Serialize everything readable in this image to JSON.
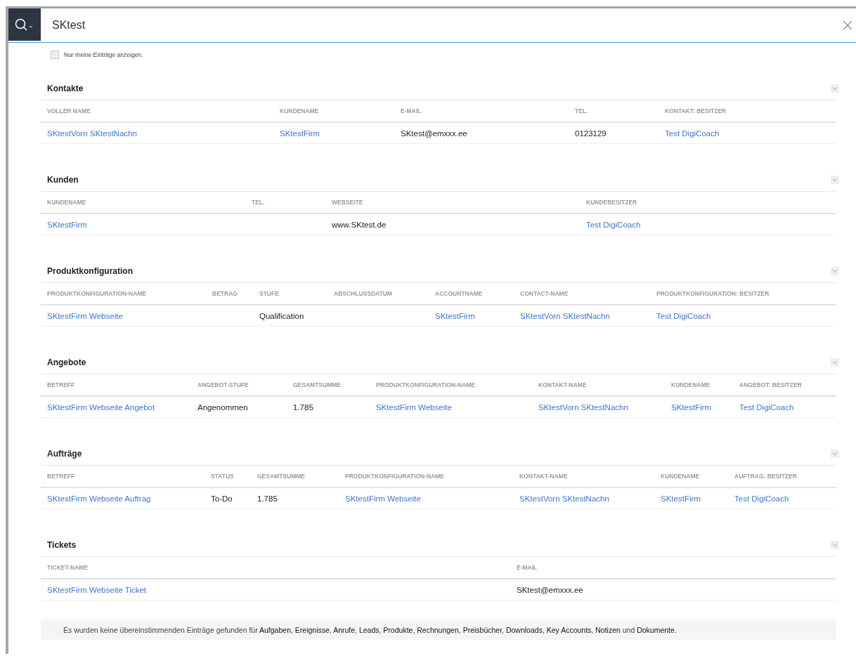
{
  "search": {
    "value": "SKtest"
  },
  "filter": {
    "label": "Nur meine Einträge anzeigen.",
    "checked": false
  },
  "sections": [
    {
      "title": "Kontakte",
      "expanded": true,
      "columns": [
        "VOLLER NAME",
        "KUNDENAME",
        "E-MAIL",
        "TEL.",
        "KONTAKT: BESITZER"
      ],
      "rows": [
        [
          {
            "text": "SKtestVorn SKtestNachn",
            "kind": "link"
          },
          {
            "text": "SKtestFirm",
            "kind": "link"
          },
          {
            "text": "SKtest@emxxx.ee",
            "kind": "text"
          },
          {
            "text": "0123129",
            "kind": "text"
          },
          {
            "text": "Test DigiCoach",
            "kind": "link"
          }
        ]
      ]
    },
    {
      "title": "Kunden",
      "expanded": true,
      "columns": [
        "KUNDENAME",
        "TEL.",
        "WEBSEITE",
        "KUNDEBESITZER"
      ],
      "rows": [
        [
          {
            "text": "SKtestFirm",
            "kind": "link"
          },
          null,
          {
            "text": "www.SKtest.de",
            "kind": "text"
          },
          {
            "text": "Test DigiCoach",
            "kind": "link"
          }
        ]
      ]
    },
    {
      "title": "Produktkonfiguration",
      "expanded": true,
      "columns": [
        "PRODUKTKONFIGURATION-NAME",
        "BETRAG",
        "STUFE",
        "ABSCHLUSSDATUM",
        "ACCOUNTNAME",
        "CONTACT-NAME",
        "PRODUKTKONFIGURATION: BESITZER"
      ],
      "rows": [
        [
          {
            "text": "SKtestFirm Webseite",
            "kind": "link"
          },
          null,
          {
            "text": "Qualification",
            "kind": "text"
          },
          null,
          {
            "text": "SKtestFirm",
            "kind": "link"
          },
          {
            "text": "SKtestVorn SKtestNachn",
            "kind": "link"
          },
          {
            "text": "Test DigiCoach",
            "kind": "link"
          }
        ]
      ]
    },
    {
      "title": "Angebote",
      "expanded": true,
      "columns": [
        "BETREFF",
        "ANGEBOT-STUFE",
        "GESAMTSUMME",
        "PRODUKTKONFIGURATION-NAME",
        "KONTAKT-NAME",
        "KUNDENAME",
        "ANGEBOT: BESITZER"
      ],
      "rows": [
        [
          {
            "text": "SKtestFirm Webseite Angebot",
            "kind": "link"
          },
          {
            "text": "Angenommen",
            "kind": "text"
          },
          {
            "text": "1.785",
            "kind": "text"
          },
          {
            "text": "SKtestFirm Webseite",
            "kind": "link"
          },
          {
            "text": "SKtestVorn SKtestNachn",
            "kind": "link"
          },
          {
            "text": "SKtestFirm",
            "kind": "link"
          },
          {
            "text": "Test DigiCoach",
            "kind": "link"
          }
        ]
      ]
    },
    {
      "title": "Aufträge",
      "expanded": true,
      "columns": [
        "BETREFF",
        "STATUS",
        "GESAMTSUMME",
        "PRODUKTKONFIGURATION-NAME",
        "KONTAKT-NAME",
        "KUNDENAME",
        "AUFTRAG: BESITZER"
      ],
      "rows": [
        [
          {
            "text": "SKtestFirm Webseite Auftrag",
            "kind": "link"
          },
          {
            "text": "To-Do",
            "kind": "text"
          },
          {
            "text": "1.785",
            "kind": "text"
          },
          {
            "text": "SKtestFirm Webseite",
            "kind": "link"
          },
          {
            "text": "SKtestVorn SKtestNachn",
            "kind": "link"
          },
          {
            "text": "SKtestFirm",
            "kind": "link"
          },
          {
            "text": "Test DigiCoach",
            "kind": "link"
          }
        ]
      ]
    },
    {
      "title": "Tickets",
      "expanded": true,
      "columns": [
        "TICKET-NAME",
        "E-MAIL"
      ],
      "rows": [
        [
          {
            "text": "SKtestFirm Webseite Ticket",
            "kind": "link"
          },
          {
            "text": "SKtest@emxxx.ee",
            "kind": "text"
          }
        ]
      ]
    }
  ],
  "footer": "Es wurden keine übereinstimmenden Einträge gefunden für **Aufgaben**, **Ereignisse**, **Anrufe**, **Leads**, **Produkte**, **Rechnungen**, **Preisbücher**, **Downloads**, **Key Accounts**, **Notizen** und **Dokumente**."
}
